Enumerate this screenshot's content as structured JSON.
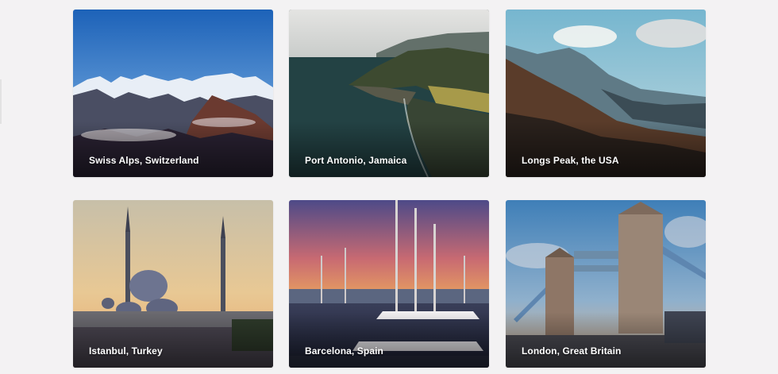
{
  "destinations": [
    {
      "label": "Swiss Alps, Switzerland",
      "image": "alpine-mountains-photo"
    },
    {
      "label": "Port Antonio, Jamaica",
      "image": "coastal-cliffs-photo"
    },
    {
      "label": "Longs Peak, the USA",
      "image": "mountain-valley-photo"
    },
    {
      "label": "Istanbul, Turkey",
      "image": "mosque-minarets-photo"
    },
    {
      "label": "Barcelona, Spain",
      "image": "marina-sunset-photo"
    },
    {
      "label": "London, Great Britain",
      "image": "tower-bridge-photo"
    }
  ]
}
